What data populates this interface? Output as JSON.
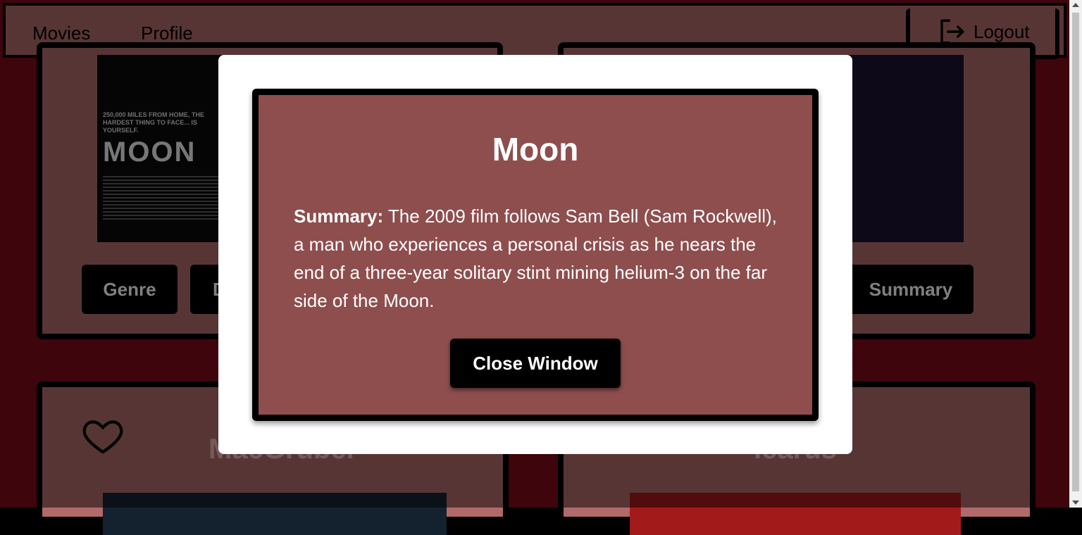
{
  "nav": {
    "movies_label": "Movies",
    "profile_label": "Profile",
    "logout_label": "Logout"
  },
  "background_cards": [
    {
      "poster": {
        "tagline": "250,000 MILES FROM HOME, THE HARDEST THING TO FACE... IS YOURSELF.",
        "title": "MOON"
      },
      "buttons": [
        "Genre",
        "D"
      ]
    },
    {
      "buttons": [
        "Summary"
      ]
    },
    {
      "title": "MacGruber"
    },
    {
      "title": "Icarus"
    }
  ],
  "modal": {
    "title": "Moon",
    "summary_label": "Summary:",
    "summary_text": "The 2009 film follows Sam Bell (Sam Rockwell), a man who experiences a personal crisis as he nears the end of a three-year solitary stint mining helium-3 on the far side of the Moon.",
    "close_label": "Close Window"
  },
  "colors": {
    "page_bg": "#7d0a1a",
    "card_bg": "#b06a6a",
    "modal_inner_bg": "#8e4e4e",
    "button_bg": "#000000"
  },
  "icons": [
    "logout-icon",
    "heart-icon"
  ]
}
